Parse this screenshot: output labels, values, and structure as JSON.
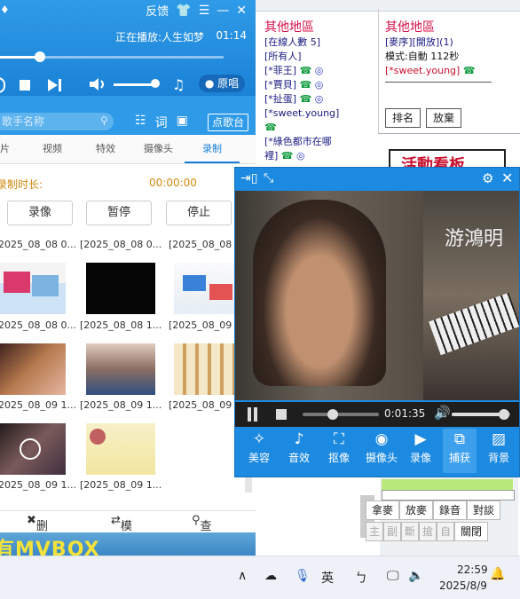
{
  "player": {
    "header_feedback": "反馈",
    "now_playing": "正在播放:人生如梦",
    "elapsed": "01:14",
    "progress_fraction": 0.18,
    "original_vocal": "原唱",
    "search_placeholder": "歌手名称",
    "lyric_button": "词",
    "order_button": "点歌台",
    "tabs": [
      "片",
      "视频",
      "特效",
      "摄像头",
      "录制"
    ],
    "active_tab": "录制",
    "record_label": "录制时长:",
    "record_time": "00:00:00",
    "record_buttons": [
      "录像",
      "暂停",
      "停止"
    ],
    "thumb_captions": [
      "2025_08_08 0...",
      "[2025_08_08 0...",
      "[2025_08_08 0...",
      "2025_08_08 0...",
      "[2025_08_08 1...",
      "[2025_08_09 0...",
      "2025_08_09 1...",
      "[2025_08_09 1...",
      "[2025_08_09 1...",
      "2025_08_09 1...",
      "[2025_08_09 1..."
    ],
    "bottom_actions": [
      "删除",
      "模式",
      "查询"
    ],
    "banner": "有MVBOX"
  },
  "chat": {
    "left_zone_title": "其他地區",
    "left_lines": [
      "[在線人數 5]",
      "[所有人]",
      "[*菲王]",
      "[*賈貝]",
      "[*扯蛋]",
      "[*sweet.young]",
      "[*綠色都市在哪",
      "裡]"
    ],
    "right_zone_title": "其他地區",
    "right_lines": [
      "[麥序][開放](1)",
      "模式:自動 112秒",
      "[*sweet.young]"
    ],
    "right_buttons": [
      "排名",
      "放棄"
    ],
    "event_board": "活動看板",
    "bottom_buttons_row1": [
      "拿麥",
      "放麥",
      "錄音",
      "對談"
    ],
    "bottom_buttons_row2": [
      "主",
      "副",
      "斷",
      "搶",
      "自",
      "關閉"
    ]
  },
  "video": {
    "overlay_name": "游鴻明",
    "time": "0:01:35",
    "playback_fraction": 0.4,
    "volume_fraction": 0.9,
    "tools": [
      "美容",
      "音效",
      "抠像",
      "摄像头",
      "录像",
      "捕获",
      "背景"
    ],
    "active_tool": "捕获"
  },
  "taskbar": {
    "ime": "英",
    "time": "22:59",
    "date": "2025/8/9"
  }
}
